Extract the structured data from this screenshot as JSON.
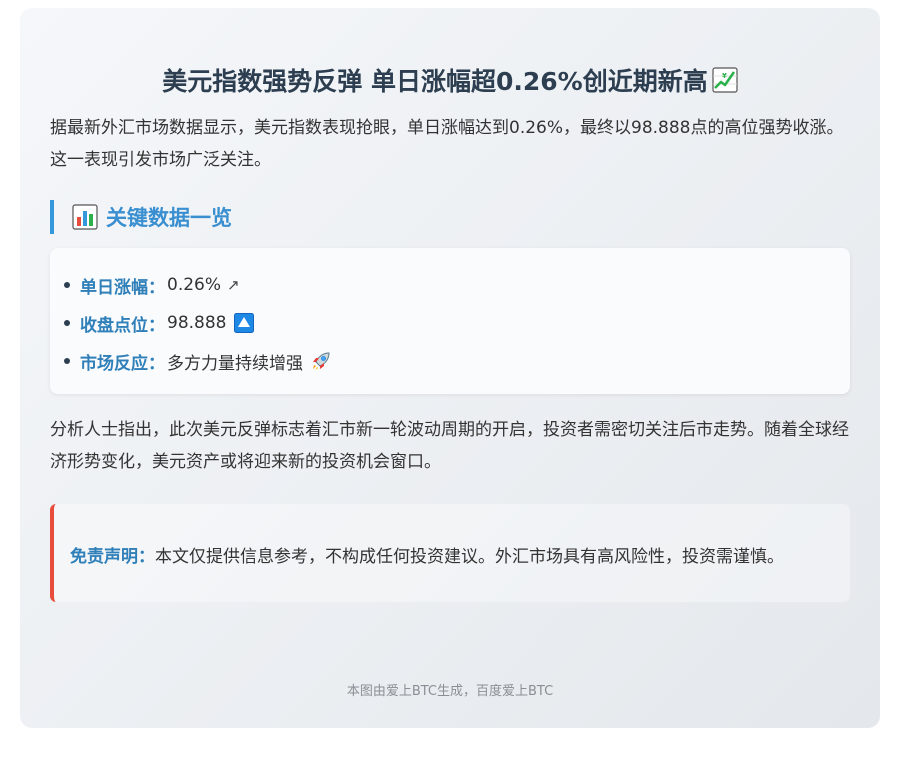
{
  "article": {
    "title": "美元指数强势反弹 单日涨幅超0.26%创近期新高",
    "title_icon": "chart-increasing-icon",
    "intro": "据最新外汇市场数据显示，美元指数表现抢眼，单日涨幅达到0.26%，最终以98.888点的高位强势收涨。这一表现引发市场广泛关注。",
    "section_title": "关键数据一览",
    "section_icon": "bar-chart-icon",
    "key_data": [
      {
        "label": "单日涨幅：",
        "value": "0.26%",
        "icon": "arrow-up-right-icon"
      },
      {
        "label": "收盘点位：",
        "value": "98.888",
        "icon": "up-button-icon"
      },
      {
        "label": "市场反应：",
        "value": "多方力量持续增强",
        "icon": "rocket-icon"
      }
    ],
    "analysis": "分析人士指出，此次美元反弹标志着汇市新一轮波动周期的开启，投资者需密切关注后市走势。随着全球经济形势变化，美元资产或将迎来新的投资机会窗口。",
    "disclaimer_label": "免责声明：",
    "disclaimer_text": "本文仅提供信息参考，不构成任何投资建议。外汇市场具有高风险性，投资需谨慎。",
    "footer": "本图由爱上BTC生成，百度爱上BTC"
  },
  "colors": {
    "accent_blue": "#3498db",
    "label_blue": "#2f7fb9",
    "disclaimer_red": "#e74c3c",
    "title": "#2c3e50"
  }
}
